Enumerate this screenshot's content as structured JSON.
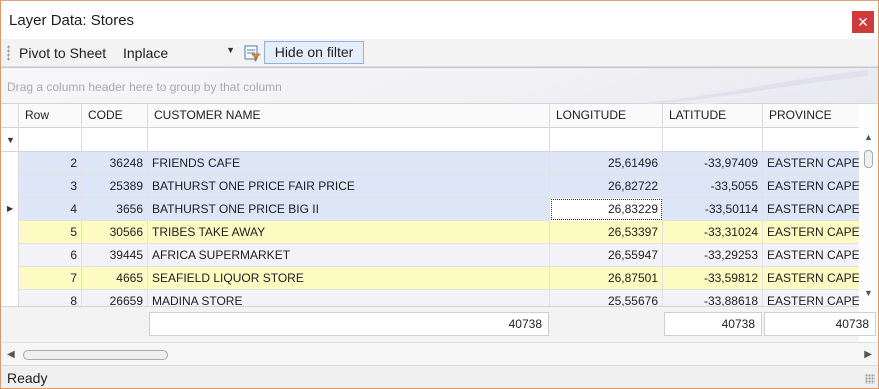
{
  "window": {
    "title": "Layer Data: Stores",
    "close_glyph": "✕"
  },
  "toolbar": {
    "pivot_label": "Pivot to Sheet",
    "mode_value": "Inplace",
    "hide_filter_label": "Hide on filter"
  },
  "grid": {
    "group_panel_text": "Drag a column header here to group by that column",
    "columns": [
      "Row",
      "CODE",
      "CUSTOMER NAME",
      "LONGITUDE",
      "LATITUDE",
      "PROVINCE"
    ],
    "rows": [
      {
        "row": "2",
        "code": "36248",
        "name": "FRIENDS CAFE",
        "longitude": "25,61496",
        "latitude": "-33,97409",
        "province": "EASTERN CAPE",
        "style": "selected"
      },
      {
        "row": "3",
        "code": "25389",
        "name": "BATHURST ONE PRICE FAIR PRICE",
        "longitude": "26,82722",
        "latitude": "-33,5055",
        "province": "EASTERN CAPE",
        "style": "selected"
      },
      {
        "row": "4",
        "code": "3656",
        "name": "BATHURST ONE PRICE BIG II",
        "longitude": "26,83229",
        "latitude": "-33,50114",
        "province": "EASTERN CAPE",
        "style": "selected",
        "current": true
      },
      {
        "row": "5",
        "code": "30566",
        "name": "TRIBES TAKE AWAY",
        "longitude": "26,53397",
        "latitude": "-33,31024",
        "province": "EASTERN CAPE",
        "style": "highlight"
      },
      {
        "row": "6",
        "code": "39445",
        "name": "AFRICA SUPERMARKET",
        "longitude": "26,55947",
        "latitude": "-33,29253",
        "province": "EASTERN CAPE",
        "style": "alt"
      },
      {
        "row": "7",
        "code": "4665",
        "name": "SEAFIELD LIQUOR STORE",
        "longitude": "26,87501",
        "latitude": "-33,59812",
        "province": "EASTERN CAPE",
        "style": "highlight"
      },
      {
        "row": "8",
        "code": "26659",
        "name": "MADINA STORE",
        "longitude": "25,55676",
        "latitude": "-33,88618",
        "province": "EASTERN CAPE",
        "style": "alt"
      }
    ],
    "footer": {
      "name_total": "40738",
      "latitude_total": "40738",
      "province_total": "40738"
    }
  },
  "status": {
    "text": "Ready"
  },
  "colors": {
    "selected_row": "#dce6f7",
    "highlight_row": "#fdfbc2",
    "alt_row": "#f2f2f8",
    "close_button": "#cf3a3a",
    "hide_button_border": "#8db2e3"
  }
}
